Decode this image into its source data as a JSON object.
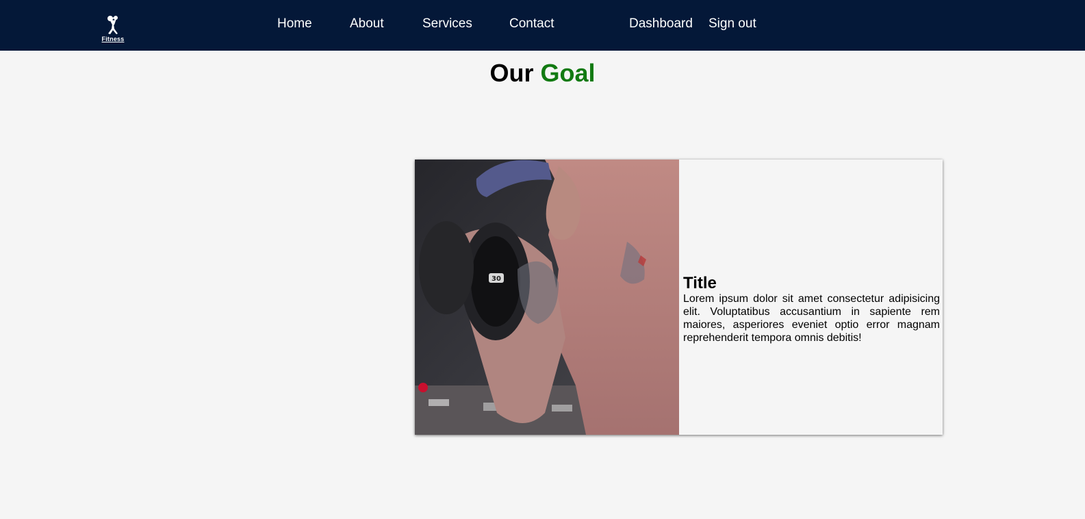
{
  "nav": {
    "logo_text": "Fitness",
    "links": {
      "home": "Home",
      "about": "About",
      "services": "Services",
      "contact": "Contact",
      "dashboard": "Dashboard",
      "sign_out": "Sign out"
    }
  },
  "section": {
    "heading_part1": "Our",
    "heading_part2": "Goal"
  },
  "card": {
    "image_icon": "man-lifting-dumbbell-photo",
    "dumbbell_label": "30",
    "title": "Title",
    "text": "Lorem ipsum dolor sit amet consectetur adipisicing elit. Voluptatibus accusantium in sapiente rem maiores, asperiores eveniet optio error magnam reprehenderit tempora omnis debitis!"
  },
  "colors": {
    "navbar": "#041838",
    "accent": "#127a12",
    "background": "#f5f5f5"
  }
}
